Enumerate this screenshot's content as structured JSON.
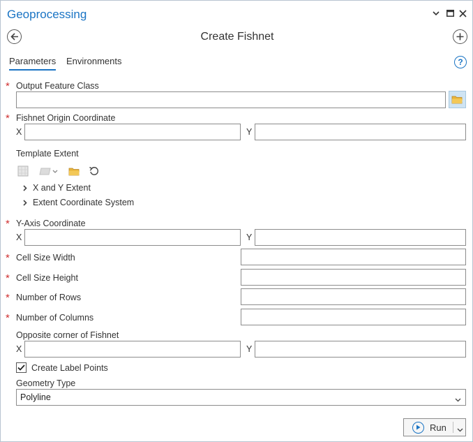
{
  "window": {
    "title": "Geoprocessing",
    "controls": [
      "chevron-down-icon",
      "maximize-icon",
      "close-icon"
    ]
  },
  "tool": {
    "title": "Create Fishnet",
    "back_icon": "back-arrow-icon",
    "add_icon": "plus-circle-icon"
  },
  "tabs": [
    {
      "label": "Parameters",
      "active": true
    },
    {
      "label": "Environments",
      "active": false
    }
  ],
  "help": {
    "glyph": "?"
  },
  "required_mark": "*",
  "xy_labels": {
    "x": "X",
    "y": "Y"
  },
  "params": {
    "output_feature_class": {
      "label": "Output Feature Class",
      "value": "",
      "required": true
    },
    "fishnet_origin": {
      "label": "Fishnet Origin Coordinate",
      "x": "",
      "y": "",
      "required": true
    },
    "template_extent": {
      "label": "Template Extent",
      "toolbar_icons": [
        "extent-grid-icon",
        "layer-dropdown-icon",
        "folder-icon",
        "reset-icon"
      ],
      "expanders": [
        "X and Y Extent",
        "Extent Coordinate System"
      ]
    },
    "y_axis": {
      "label": "Y-Axis Coordinate",
      "x": "",
      "y": "",
      "required": true
    },
    "cell_size_width": {
      "label": "Cell Size Width",
      "value": "",
      "required": true
    },
    "cell_size_height": {
      "label": "Cell Size Height",
      "value": "",
      "required": true
    },
    "number_of_rows": {
      "label": "Number of Rows",
      "value": "",
      "required": true
    },
    "number_of_columns": {
      "label": "Number of Columns",
      "value": "",
      "required": true
    },
    "opposite_corner": {
      "label": "Opposite corner of Fishnet",
      "x": "",
      "y": "",
      "required": false
    },
    "create_label_points": {
      "label": "Create Label Points",
      "checked": true
    },
    "geometry_type": {
      "label": "Geometry Type",
      "value": "Polyline"
    }
  },
  "run_button": {
    "label": "Run"
  },
  "colors": {
    "accent": "#1a74c4",
    "required": "#d03030",
    "folder": "#e8b43a"
  }
}
